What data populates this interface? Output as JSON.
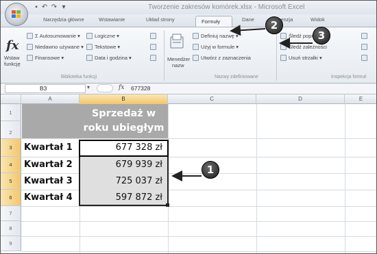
{
  "window": {
    "title": "Tworzenie zakresów komórek.xlsx - Microsoft Excel"
  },
  "ribbon_tabs": [
    {
      "label": "Narzędzia główne"
    },
    {
      "label": "Wstawianie"
    },
    {
      "label": "Układ strony"
    },
    {
      "label": "Formuły",
      "active": true
    },
    {
      "label": "Dane"
    },
    {
      "label": "Recenzja"
    },
    {
      "label": "Widok"
    }
  ],
  "ribbon": {
    "insert_function": {
      "label_line1": "Wstaw",
      "label_line2": "funkcję"
    },
    "library": {
      "items": [
        "Σ Autosumowanie ▾",
        "Niedawno używane ▾",
        "Finansowe ▾",
        "Logiczne ▾",
        "Tekstowe ▾",
        "Data i godzina ▾"
      ],
      "group_label": "Biblioteka funkcji"
    },
    "names": {
      "manager_line1": "Menedżer",
      "manager_line2": "nazw",
      "items": [
        "Definiuj nazwę ▾",
        "Użyj w formule ▾",
        "Utwórz z zaznaczenia"
      ],
      "group_label": "Nazwy zdefiniowane"
    },
    "audit": {
      "items": [
        "Śledź poprzedniki",
        "Śledź zależności",
        "Usuń strzałki ▾"
      ],
      "group_label": "Inspekcja formuł"
    }
  },
  "formula_bar": {
    "name_box": "B3",
    "fx": "fx",
    "value": "677328"
  },
  "columns": [
    "A",
    "B",
    "C",
    "D",
    "E"
  ],
  "rows": [
    "1",
    "2",
    "3",
    "4",
    "5",
    "6",
    "7",
    "8",
    "9"
  ],
  "sheet": {
    "header_line1": "Sprzedaż w",
    "header_line2": "roku ubiegłym",
    "data": [
      {
        "label": "Kwartał 1",
        "value": "677 328 zł"
      },
      {
        "label": "Kwartał 2",
        "value": "679 939 zł"
      },
      {
        "label": "Kwartał 3",
        "value": "725 037 zł"
      },
      {
        "label": "Kwartał 4",
        "value": "597 872 zł"
      }
    ]
  },
  "callouts": [
    "1",
    "2",
    "3"
  ]
}
